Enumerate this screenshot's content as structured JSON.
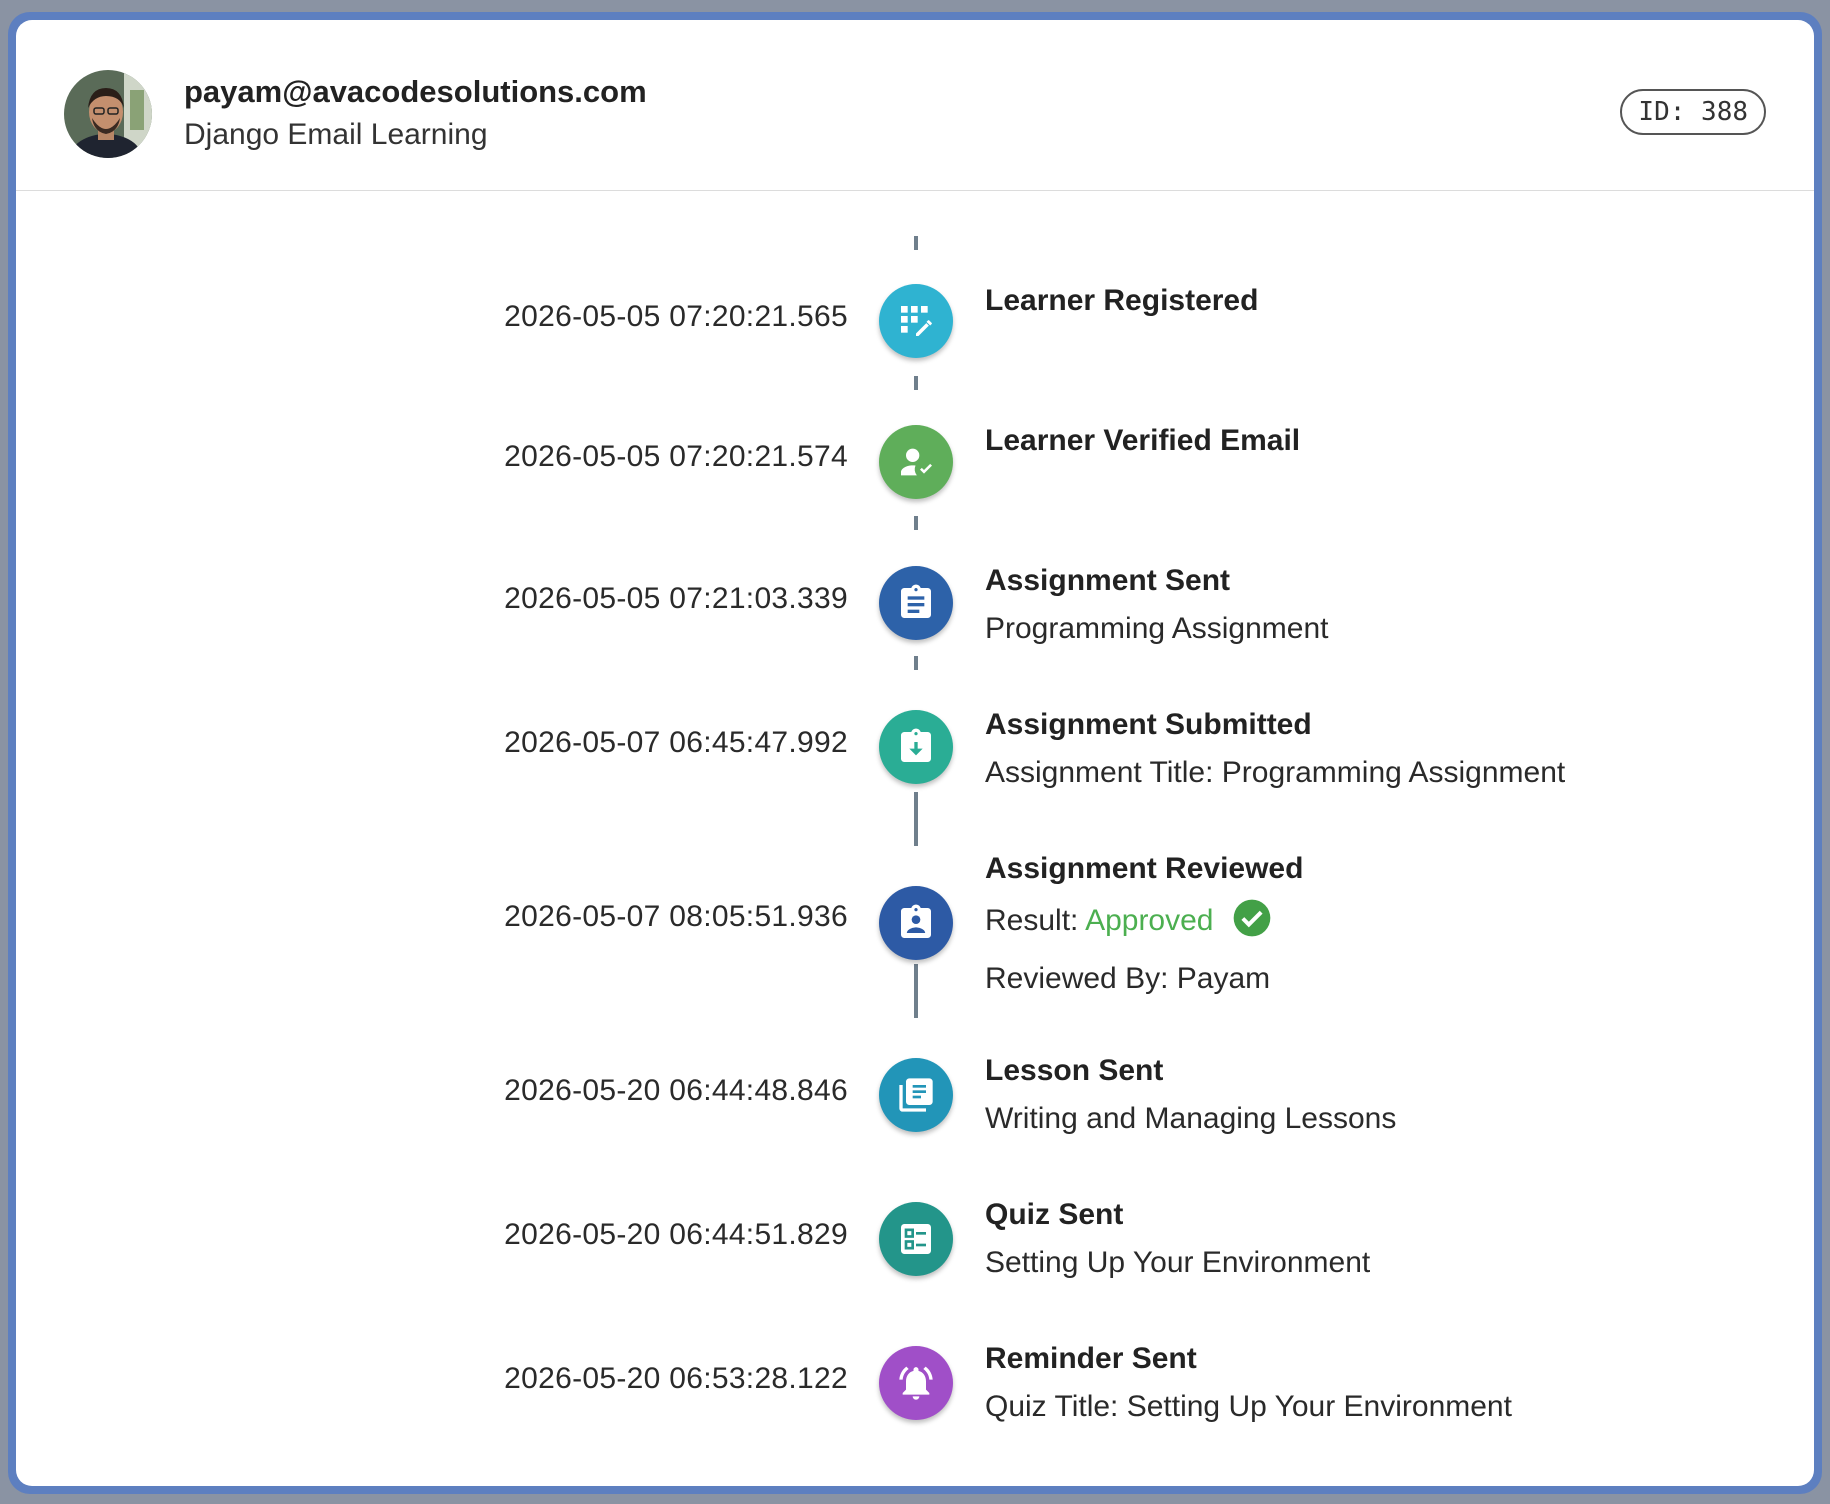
{
  "user": {
    "email": "payam@avacodesolutions.com",
    "course": "Django Email Learning",
    "id_label": "ID: 388"
  },
  "colors": {
    "cyan": "#2fb3d1",
    "green": "#5fae5a",
    "navy": "#2d62a9",
    "teal": "#2aad95",
    "blue_teal": "#2295b8",
    "dark_teal": "#23958a",
    "purple": "#a04fc8",
    "approved": "#4caf50"
  },
  "events": [
    {
      "time": "2026-05-05 07:20:21.565",
      "title": "Learner Registered",
      "icon": "app-registration-icon"
    },
    {
      "time": "2026-05-05 07:20:21.574",
      "title": "Learner Verified Email",
      "icon": "person-check-icon"
    },
    {
      "time": "2026-05-05 07:21:03.339",
      "title": "Assignment Sent",
      "subtitle": "Programming Assignment",
      "icon": "clipboard-list-icon"
    },
    {
      "time": "2026-05-07 06:45:47.992",
      "title": "Assignment Submitted",
      "subtitle": "Assignment Title: Programming Assignment",
      "icon": "clipboard-download-icon"
    },
    {
      "time": "2026-05-07 08:05:51.936",
      "title": "Assignment Reviewed",
      "result_label": "Result:",
      "result_value": "Approved",
      "reviewer": "Reviewed By: Payam",
      "icon": "clipboard-person-icon"
    },
    {
      "time": "2026-05-20 06:44:48.846",
      "title": "Lesson Sent",
      "subtitle": "Writing and Managing Lessons",
      "icon": "library-books-icon"
    },
    {
      "time": "2026-05-20 06:44:51.829",
      "title": "Quiz Sent",
      "subtitle": "Setting Up Your Environment",
      "icon": "quiz-list-icon"
    },
    {
      "time": "2026-05-20 06:53:28.122",
      "title": "Reminder Sent",
      "subtitle": "Quiz Title: Setting Up Your Environment",
      "icon": "bell-ringing-icon"
    }
  ]
}
